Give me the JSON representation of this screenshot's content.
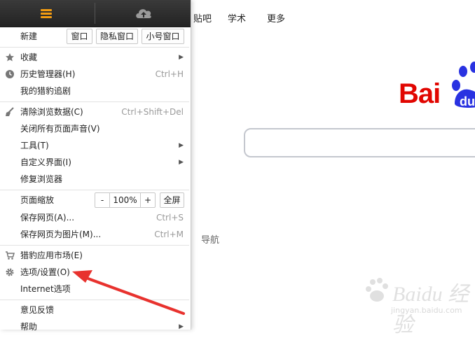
{
  "background_page": {
    "top_links": [
      "贴吧",
      "学术",
      "更多"
    ],
    "logo_text": "Bai",
    "nav_text": "导航",
    "watermark_text": "Baidu 经验",
    "watermark_url": "jingyan.baidu.com",
    "brand_red": "#e10601",
    "brand_blue": "#2932e1"
  },
  "menu": {
    "top_icons": [
      "menu-hamburger-icon",
      "cloud-icon"
    ],
    "new_label": "新建",
    "new_buttons": [
      "窗口",
      "隐私窗口",
      "小号窗口"
    ],
    "group1": [
      {
        "label": "收藏",
        "icon": "star-icon",
        "submenu": true
      },
      {
        "label": "历史管理器(H)",
        "icon": "clock-icon",
        "shortcut": "Ctrl+H"
      },
      {
        "label": "我的猎豹追剧"
      }
    ],
    "group2": [
      {
        "label": "清除浏览数据(C)",
        "icon": "broom-icon",
        "shortcut": "Ctrl+Shift+Del"
      },
      {
        "label": "关闭所有页面声音(V)"
      },
      {
        "label": "工具(T)",
        "submenu": true
      },
      {
        "label": "自定义界面(I)",
        "submenu": true
      },
      {
        "label": "修复浏览器"
      }
    ],
    "zoom": {
      "label": "页面缩放",
      "minus": "-",
      "value": "100%",
      "plus": "+",
      "fullscreen": "全屏"
    },
    "group3": [
      {
        "label": "保存网页(A)...",
        "shortcut": "Ctrl+S"
      },
      {
        "label": "保存网页为图片(M)...",
        "shortcut": "Ctrl+M"
      }
    ],
    "group4": [
      {
        "label": "猎豹应用市场(E)",
        "icon": "cart-icon"
      },
      {
        "label": "选项/设置(O)",
        "icon": "gear-icon"
      },
      {
        "label": "Internet选项"
      }
    ],
    "group5": [
      {
        "label": "意见反馈"
      },
      {
        "label": "帮助",
        "submenu": true
      }
    ],
    "accent_color": "#f39c12",
    "annotation_arrow_color": "#e8322e"
  }
}
